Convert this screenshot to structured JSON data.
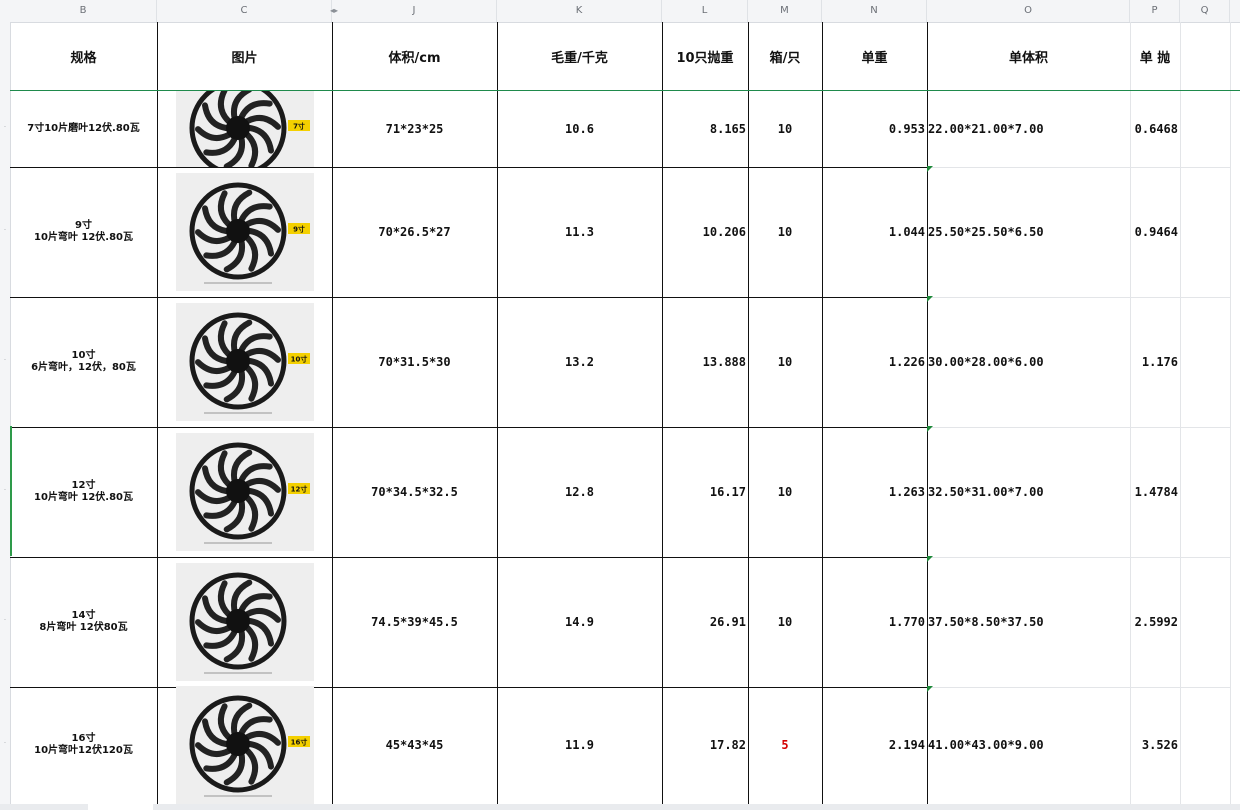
{
  "column_letters": [
    "B",
    "C",
    "J",
    "K",
    "L",
    "M",
    "N",
    "O",
    "P",
    "Q"
  ],
  "headers": {
    "spec": "规格",
    "image": "图片",
    "volume": "体积/cm",
    "gross_weight": "毛重/千克",
    "ten_pack_weight": "10只抛重",
    "per_box": "箱/只",
    "unit_weight": "单重",
    "unit_volume": "单体积",
    "unit_throw": "单 抛"
  },
  "rows": [
    {
      "spec": "7寸10片磨叶12伏.80瓦",
      "size_tag": "7寸",
      "volume": "71*23*25",
      "gross_weight": "10.6",
      "ten_pack_weight": "8.165",
      "per_box": "10",
      "unit_weight": "0.953",
      "unit_volume": "22.00*21.00*7.00",
      "unit_throw": "0.6468"
    },
    {
      "spec": "9寸\n10片弯叶 12伏.80瓦",
      "size_tag": "9寸",
      "volume": "70*26.5*27",
      "gross_weight": "11.3",
      "ten_pack_weight": "10.206",
      "per_box": "10",
      "unit_weight": "1.044",
      "unit_volume": "25.50*25.50*6.50",
      "unit_throw": "0.9464"
    },
    {
      "spec": "10寸\n6片弯叶，12伏，80瓦",
      "size_tag": "10寸",
      "volume": "70*31.5*30",
      "gross_weight": "13.2",
      "ten_pack_weight": "13.888",
      "per_box": "10",
      "unit_weight": "1.226",
      "unit_volume": "30.00*28.00*6.00",
      "unit_throw": "1.176"
    },
    {
      "spec": "12寸\n10片弯叶 12伏.80瓦",
      "size_tag": "12寸",
      "volume": "70*34.5*32.5",
      "gross_weight": "12.8",
      "ten_pack_weight": "16.17",
      "per_box": "10",
      "unit_weight": "1.263",
      "unit_volume": "32.50*31.00*7.00",
      "unit_throw": "1.4784"
    },
    {
      "spec": "14寸\n8片弯叶  12伏80瓦",
      "size_tag": "",
      "volume": "74.5*39*45.5",
      "gross_weight": "14.9",
      "ten_pack_weight": "26.91",
      "per_box": "10",
      "unit_weight": "1.770",
      "unit_volume": "37.50*8.50*37.50",
      "unit_throw": "2.5992"
    },
    {
      "spec": "16寸\n10片弯叶12伏120瓦",
      "size_tag": "16寸",
      "volume": "45*43*45",
      "gross_weight": "11.9",
      "ten_pack_weight": "17.82",
      "per_box": "5",
      "unit_weight": "2.194",
      "unit_volume": "41.00*43.00*9.00",
      "unit_throw": "3.526"
    }
  ],
  "colors": {
    "accent_green": "#1f8a4c",
    "red_value": "#d40000",
    "tag_yellow": "#f4d000"
  }
}
